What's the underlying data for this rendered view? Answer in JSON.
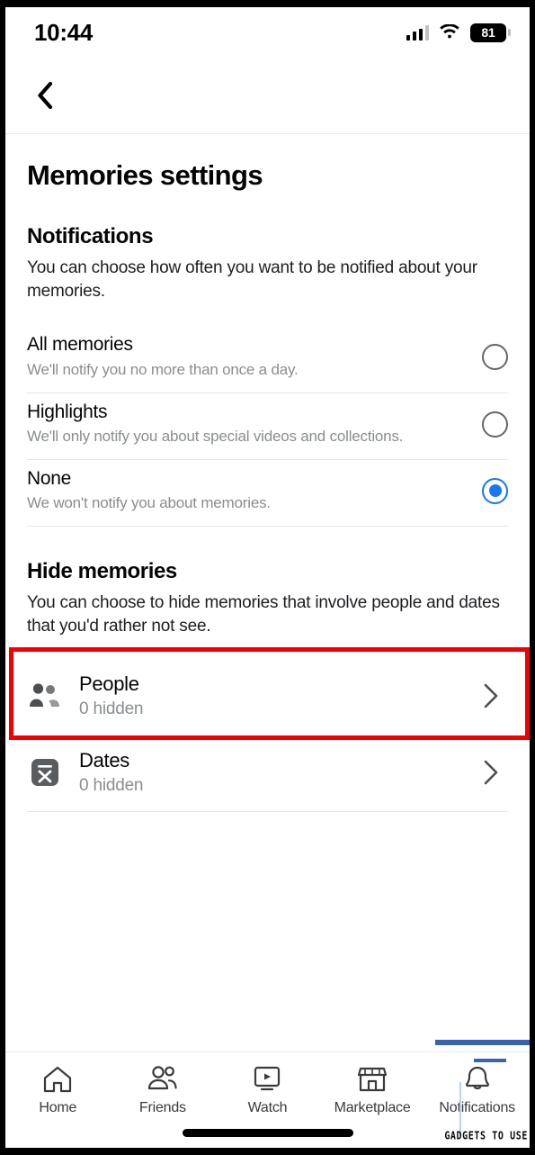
{
  "status_bar": {
    "time": "10:44",
    "battery_level": "81",
    "signal_icon": "cellular-signal-icon",
    "wifi_icon": "wifi-icon",
    "battery_icon": "battery-icon"
  },
  "header": {
    "back_icon": "chevron-left-icon"
  },
  "page": {
    "title": "Memories settings"
  },
  "notifications": {
    "section_title": "Notifications",
    "description": "You can choose how often you want to be notified about your memories.",
    "options": [
      {
        "label": "All memories",
        "sub": "We'll notify you no more than once a day.",
        "selected": false
      },
      {
        "label": "Highlights",
        "sub": "We'll only notify you about special videos and collections.",
        "selected": false
      },
      {
        "label": "None",
        "sub": "We won't notify you about memories.",
        "selected": true
      }
    ]
  },
  "hide_memories": {
    "section_title": "Hide memories",
    "description": "You can choose to hide memories that involve people and dates that you'd rather not see.",
    "rows": [
      {
        "label": "People",
        "sub": "0 hidden",
        "icon": "people-icon",
        "chevron": "chevron-right-icon",
        "highlighted": true
      },
      {
        "label": "Dates",
        "sub": "0 hidden",
        "icon": "calendar-x-icon",
        "chevron": "chevron-right-icon",
        "highlighted": false
      }
    ]
  },
  "bottom_nav": {
    "items": [
      {
        "label": "Home",
        "icon": "home-icon"
      },
      {
        "label": "Friends",
        "icon": "friends-icon"
      },
      {
        "label": "Watch",
        "icon": "watch-play-icon"
      },
      {
        "label": "Marketplace",
        "icon": "marketplace-storefront-icon"
      },
      {
        "label": "Notifications",
        "icon": "bell-icon"
      }
    ]
  },
  "watermark": {
    "text": "GADGETS TO USE"
  },
  "colors": {
    "accent_blue": "#1877f2",
    "highlight_red": "#f50000",
    "muted_text": "#8a8d91",
    "watermark_blue": "#3b64b0"
  }
}
